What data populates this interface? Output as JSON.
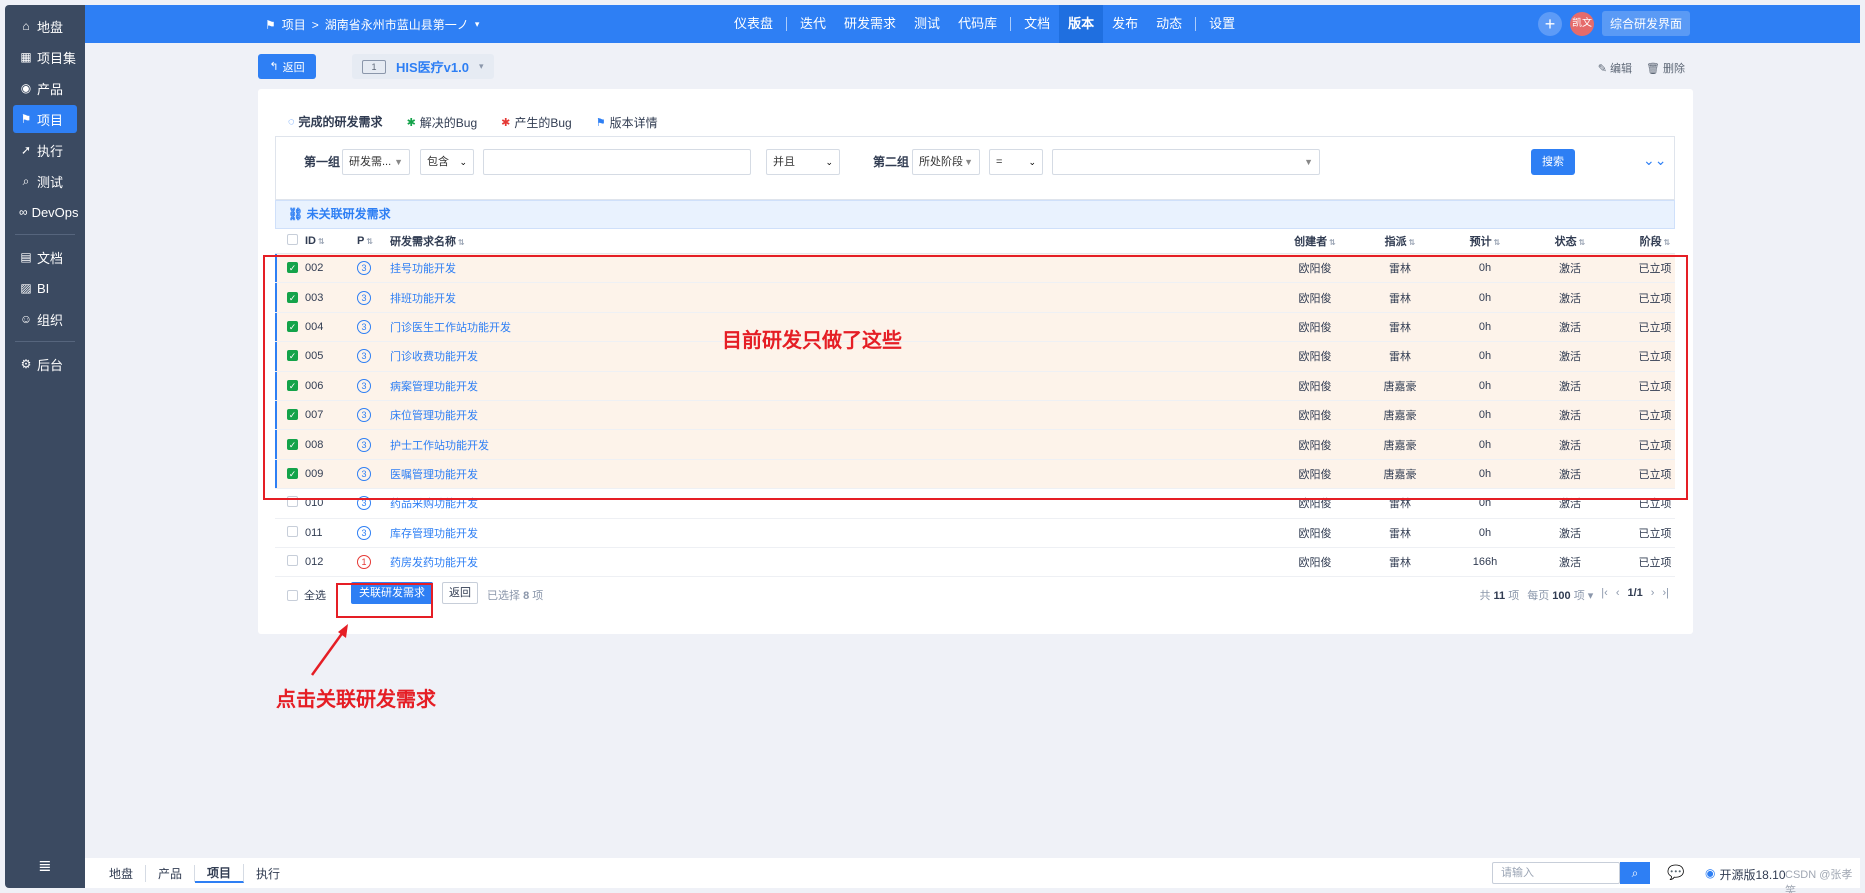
{
  "sidebar": {
    "items": [
      {
        "label": "地盘",
        "icon": "home-icon"
      },
      {
        "label": "项目集",
        "icon": "grid-icon"
      },
      {
        "label": "产品",
        "icon": "lightbulb-icon"
      },
      {
        "label": "项目",
        "icon": "project-icon",
        "active": true
      },
      {
        "label": "执行",
        "icon": "run-icon"
      },
      {
        "label": "测试",
        "icon": "search-icon"
      },
      {
        "label": "DevOps",
        "icon": "infinity-icon"
      },
      {
        "label": "文档",
        "icon": "doc-icon"
      },
      {
        "label": "BI",
        "icon": "chart-icon"
      },
      {
        "label": "组织",
        "icon": "people-icon"
      },
      {
        "label": "后台",
        "icon": "gear-icon"
      }
    ],
    "collapse_icon": "menu-icon"
  },
  "topbar": {
    "crumb_root": "项目",
    "crumb_sep": ">",
    "crumb_project": "湖南省永州市蓝山县第一ノ",
    "nav": [
      "仪表盘",
      "迭代",
      "研发需求",
      "测试",
      "代码库",
      "文档",
      "版本",
      "发布",
      "动态",
      "设置"
    ],
    "active_nav": "版本",
    "plus": "+",
    "user": "凯文",
    "mode_button": "综合研发界面"
  },
  "toolbar": {
    "back": "返回",
    "version_num": "1",
    "version_name": "HIS医疗v1.0",
    "edit": "编辑",
    "delete": "删除"
  },
  "tabs": [
    {
      "label": "完成的研发需求",
      "active": true
    },
    {
      "label": "解决的Bug"
    },
    {
      "label": "产生的Bug"
    },
    {
      "label": "版本详情"
    }
  ],
  "search": {
    "group1_label": "第一组",
    "group1_field": "研发需...",
    "group1_op": "包含",
    "group1_value": "",
    "logic": "并且",
    "group2_label": "第二组",
    "group2_field": "所处阶段",
    "group2_op": "=",
    "group2_value": "",
    "button": "搜索"
  },
  "unlinked_bar": "未关联研发需求",
  "table": {
    "headers": {
      "id": "ID",
      "p": "P",
      "name": "研发需求名称",
      "creator": "创建者",
      "assign": "指派",
      "estimate": "预计",
      "status": "状态",
      "stage": "阶段"
    },
    "rows": [
      {
        "checked": true,
        "id": "002",
        "p": "3",
        "name": "挂号功能开发",
        "creator": "欧阳俊",
        "assign": "雷林",
        "estimate": "0h",
        "status": "激活",
        "stage": "已立项"
      },
      {
        "checked": true,
        "id": "003",
        "p": "3",
        "name": "排班功能开发",
        "creator": "欧阳俊",
        "assign": "雷林",
        "estimate": "0h",
        "status": "激活",
        "stage": "已立项"
      },
      {
        "checked": true,
        "id": "004",
        "p": "3",
        "name": "门诊医生工作站功能开发",
        "creator": "欧阳俊",
        "assign": "雷林",
        "estimate": "0h",
        "status": "激活",
        "stage": "已立项"
      },
      {
        "checked": true,
        "id": "005",
        "p": "3",
        "name": "门诊收费功能开发",
        "creator": "欧阳俊",
        "assign": "雷林",
        "estimate": "0h",
        "status": "激活",
        "stage": "已立项"
      },
      {
        "checked": true,
        "id": "006",
        "p": "3",
        "name": "病案管理功能开发",
        "creator": "欧阳俊",
        "assign": "唐嘉豪",
        "estimate": "0h",
        "status": "激活",
        "stage": "已立项"
      },
      {
        "checked": true,
        "id": "007",
        "p": "3",
        "name": "床位管理功能开发",
        "creator": "欧阳俊",
        "assign": "唐嘉豪",
        "estimate": "0h",
        "status": "激活",
        "stage": "已立项"
      },
      {
        "checked": true,
        "id": "008",
        "p": "3",
        "name": "护士工作站功能开发",
        "creator": "欧阳俊",
        "assign": "唐嘉豪",
        "estimate": "0h",
        "status": "激活",
        "stage": "已立项"
      },
      {
        "checked": true,
        "id": "009",
        "p": "3",
        "name": "医嘱管理功能开发",
        "creator": "欧阳俊",
        "assign": "唐嘉豪",
        "estimate": "0h",
        "status": "激活",
        "stage": "已立项"
      },
      {
        "checked": false,
        "id": "010",
        "p": "3",
        "name": "药品采购功能开发",
        "creator": "欧阳俊",
        "assign": "雷林",
        "estimate": "0h",
        "status": "激活",
        "stage": "已立项"
      },
      {
        "checked": false,
        "id": "011",
        "p": "3",
        "name": "库存管理功能开发",
        "creator": "欧阳俊",
        "assign": "雷林",
        "estimate": "0h",
        "status": "激活",
        "stage": "已立项"
      },
      {
        "checked": false,
        "id": "012",
        "p": "1",
        "name": "药房发药功能开发",
        "creator": "欧阳俊",
        "assign": "雷林",
        "estimate": "166h",
        "status": "激活",
        "stage": "已立项"
      }
    ]
  },
  "footer": {
    "select_all": "全选",
    "link_button": "关联研发需求",
    "back": "返回",
    "selected_prefix": "已选择",
    "selected_count": "8",
    "selected_suffix": "项",
    "total_prefix": "共",
    "total_count": "11",
    "total_suffix": "项",
    "per_page_prefix": "每页",
    "per_page": "100",
    "per_page_suffix": "项",
    "page": "1/1"
  },
  "annotations": {
    "done_note": "目前研发只做了这些",
    "click_note": "点击关联研发需求",
    "color": "#e51e25"
  },
  "bottombar": {
    "nav": [
      "地盘",
      "产品",
      "项目",
      "执行"
    ],
    "active": "项目",
    "search_placeholder": "请输入",
    "brand": "开源版18.10",
    "watermark": "CSDN @张孝笑"
  },
  "colors": {
    "primary": "#2e7ff4",
    "sidebar": "#3b4a61",
    "selected_row": "#fdf3ea",
    "check_green": "#14a34a"
  }
}
